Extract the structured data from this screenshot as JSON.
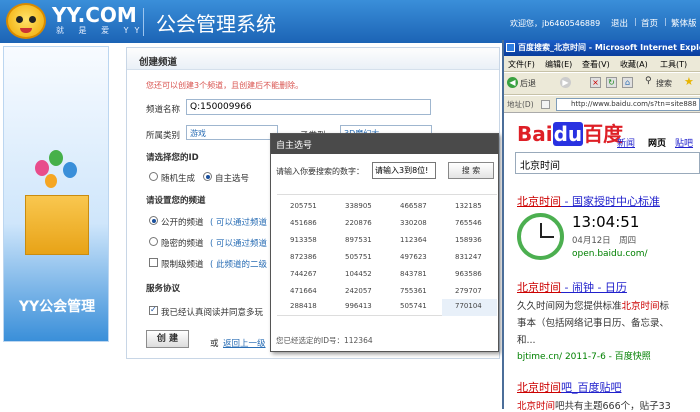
{
  "header": {
    "logo": "YY.COM",
    "logo_sub": "就 是 爱 YY",
    "site_title": "公会管理系统",
    "welcome": "欢迎您，jb6460546889",
    "links": [
      "退出",
      "首页",
      "繁体版"
    ]
  },
  "banner": {
    "title": "YY公会管理"
  },
  "form": {
    "panel_title": "创建频道",
    "notice": "您还可以创建3个频道，且创建后不能删除。",
    "name_label": "频道名称",
    "name_value": "Q:150009966",
    "category_label": "所属类别",
    "category_value": "游戏",
    "type_label": "子类型",
    "type_value": "3D魔幻大",
    "id_section": "请选择您的ID",
    "id_random": "随机生成",
    "id_custom": "自主选号",
    "channel_section": "请设置您的频道",
    "public_label": "公开的频道",
    "public_hint": "( 可以通过频道",
    "private_label": "隐密的频道",
    "private_hint": "( 可以通过频道",
    "limit_label": "限制级频道",
    "limit_hint": "( 此频道的二级",
    "service_section": "服务协议",
    "agree_label": "我已经认真阅读并同意多玩",
    "create_btn": "创 建",
    "or": "或",
    "back_link": "返回上一级"
  },
  "dialog": {
    "title": "自主选号",
    "prompt": "请输入你要搜索的数字：",
    "input_value": "请输入3到8位!",
    "search_btn": "搜 索",
    "numbers": [
      [
        "205751",
        "338905",
        "466587",
        "132185"
      ],
      [
        "451686",
        "220876",
        "330208",
        "765546"
      ],
      [
        "913358",
        "897531",
        "112364",
        "158936"
      ],
      [
        "872386",
        "505751",
        "497623",
        "831247"
      ],
      [
        "744267",
        "104452",
        "843781",
        "963586"
      ],
      [
        "471664",
        "242057",
        "755361",
        "279707"
      ],
      [
        "288418",
        "996413",
        "505741",
        "770104"
      ]
    ],
    "selected": "您已经选定的ID号：112364"
  },
  "ie": {
    "title": "百度搜索_北京时间 - Microsoft Internet Explorer",
    "menu": [
      "文件(F)",
      "编辑(E)",
      "查看(V)",
      "收藏(A)",
      "工具(T)"
    ],
    "back": "后退",
    "search": "搜索",
    "address_label": "地址(D)",
    "url": "http://www.baidu.com/s?tn=site888",
    "baidu_logo_a": "Bai",
    "baidu_logo_b": "du",
    "baidu_logo_c": "百度",
    "nav": [
      "新闻",
      "网页",
      "贴吧"
    ],
    "query": "北京时间",
    "r1_title_a": "北京时间",
    "r1_title_b": " - 国家授时中心标准",
    "time": "13:04:51",
    "date": "04月12日　周四",
    "r1_url": "open.baidu.com/",
    "r2_title_a": "北京时间",
    "r2_title_b": " - 闹钟 - 日历",
    "r2_text_a": "久久时间网为您提供标准",
    "r2_text_hl": "北京时间",
    "r2_text_b": "标",
    "r2_text2": "事本（包括网络记事日历、备忘录、",
    "r2_text3": "和...",
    "r2_url": "bjtime.cn/ 2011-7-6 - 百度快照",
    "r3_title_a": "北京时间",
    "r3_title_b": "吧_百度贴吧",
    "r3_text_a": "北京时间",
    "r3_text_b": "吧共有主题666个，贴子33"
  },
  "colors": {
    "header": "#2a78c8",
    "dialog_header": "#4a4a4a",
    "baidu_red": "#de1f26",
    "baidu_blue": "#2932e1"
  }
}
